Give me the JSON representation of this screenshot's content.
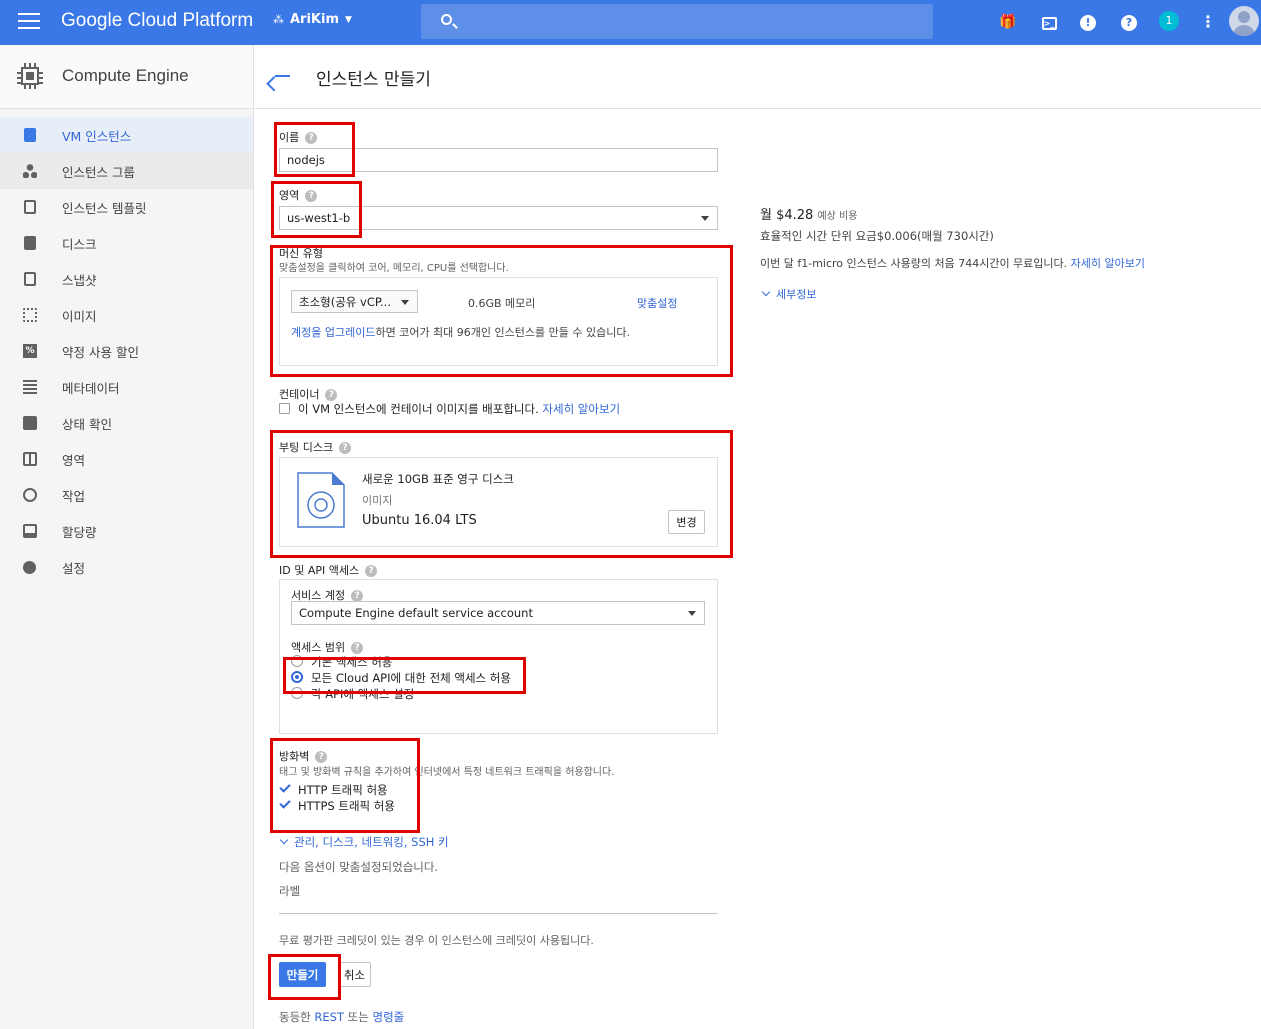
{
  "topbar": {
    "brand": "Google Cloud Platform",
    "project": "AriKim",
    "notification_count": "1"
  },
  "sidebar": {
    "title": "Compute Engine",
    "items": [
      {
        "label": "VM 인스턴스",
        "icon": "vm-instances-icon"
      },
      {
        "label": "인스턴스 그룹",
        "icon": "instance-groups-icon"
      },
      {
        "label": "인스턴스 템플릿",
        "icon": "instance-templates-icon"
      },
      {
        "label": "디스크",
        "icon": "disk-icon"
      },
      {
        "label": "스냅샷",
        "icon": "snapshot-icon"
      },
      {
        "label": "이미지",
        "icon": "image-icon"
      },
      {
        "label": "약정 사용 할인",
        "icon": "committed-use-icon"
      },
      {
        "label": "메타데이터",
        "icon": "metadata-icon"
      },
      {
        "label": "상태 확인",
        "icon": "health-check-icon"
      },
      {
        "label": "영역",
        "icon": "zones-icon"
      },
      {
        "label": "작업",
        "icon": "operations-icon"
      },
      {
        "label": "할당량",
        "icon": "quotas-icon"
      },
      {
        "label": "설정",
        "icon": "settings-icon"
      }
    ]
  },
  "page": {
    "title": "인스턴스 만들기"
  },
  "form": {
    "name_label": "이름",
    "name_value": "nodejs",
    "zone_label": "영역",
    "zone_value": "us-west1-b",
    "machine_label": "머신 유형",
    "machine_desc": "맞춤설정을 클릭하여 코어, 메모리, CPU를 선택합니다.",
    "machine_type_value": "초소형(공유 vCP...",
    "memory": "0.6GB 메모리",
    "customize": "맞춤설정",
    "upgrade_link": "계정을 업그레이드",
    "upgrade_text": "하면 코어가 최대 96개인 인스턴스를 만들 수 있습니다.",
    "container_label": "컨테이너",
    "container_text": "이 VM 인스턴스에 컨테이너 이미지를 배포합니다.",
    "learn_more": "자세히 알아보기",
    "boot_disk_label": "부팅 디스크",
    "boot_disk_title": "새로운 10GB 표준 영구 디스크",
    "boot_disk_image_label": "이미지",
    "boot_disk_image": "Ubuntu 16.04 LTS",
    "change": "변경",
    "id_api_label": "ID 및 API 액세스",
    "service_account_label": "서비스 계정",
    "service_account_value": "Compute Engine default service account",
    "access_scope_label": "액세스 범위",
    "scope_options": [
      "기본 액세스 허용",
      "모든 Cloud API에 대한 전체 액세스 허용",
      "각 API에 액세스 설정"
    ],
    "firewall_label": "방화벽",
    "firewall_desc": "태그 및 방화벽 규칙을 추가하여 인터넷에서 특정 네트워크 트래픽을 허용합니다.",
    "http_label": "HTTP 트래픽 허용",
    "https_label": "HTTPS 트래픽 허용",
    "advanced_link": "관리, 디스크, 네트워킹, SSH 키",
    "customized_note": "다음 옵션이 맞춤설정되었습니다.",
    "label_text": "라벨",
    "credit_note": "무료 평가판 크레딧이 있는 경우 이 인스턴스에 크레딧이 사용됩니다.",
    "create": "만들기",
    "cancel": "취소",
    "equivalent": "동등한",
    "rest": "REST",
    "or": "또는",
    "command_line": "명령줄"
  },
  "pricing": {
    "monthly": "월 $4.28",
    "estimated": "예상 비용",
    "hourly": "효율적인 시간 단위 요금$0.006(매월 730시간)",
    "free_tier": "이번 달 f1-micro 인스턴스 사용량의 처음 744시간이 무료입니다.",
    "learn_more": "자세히 알아보기",
    "details": "세부정보"
  }
}
